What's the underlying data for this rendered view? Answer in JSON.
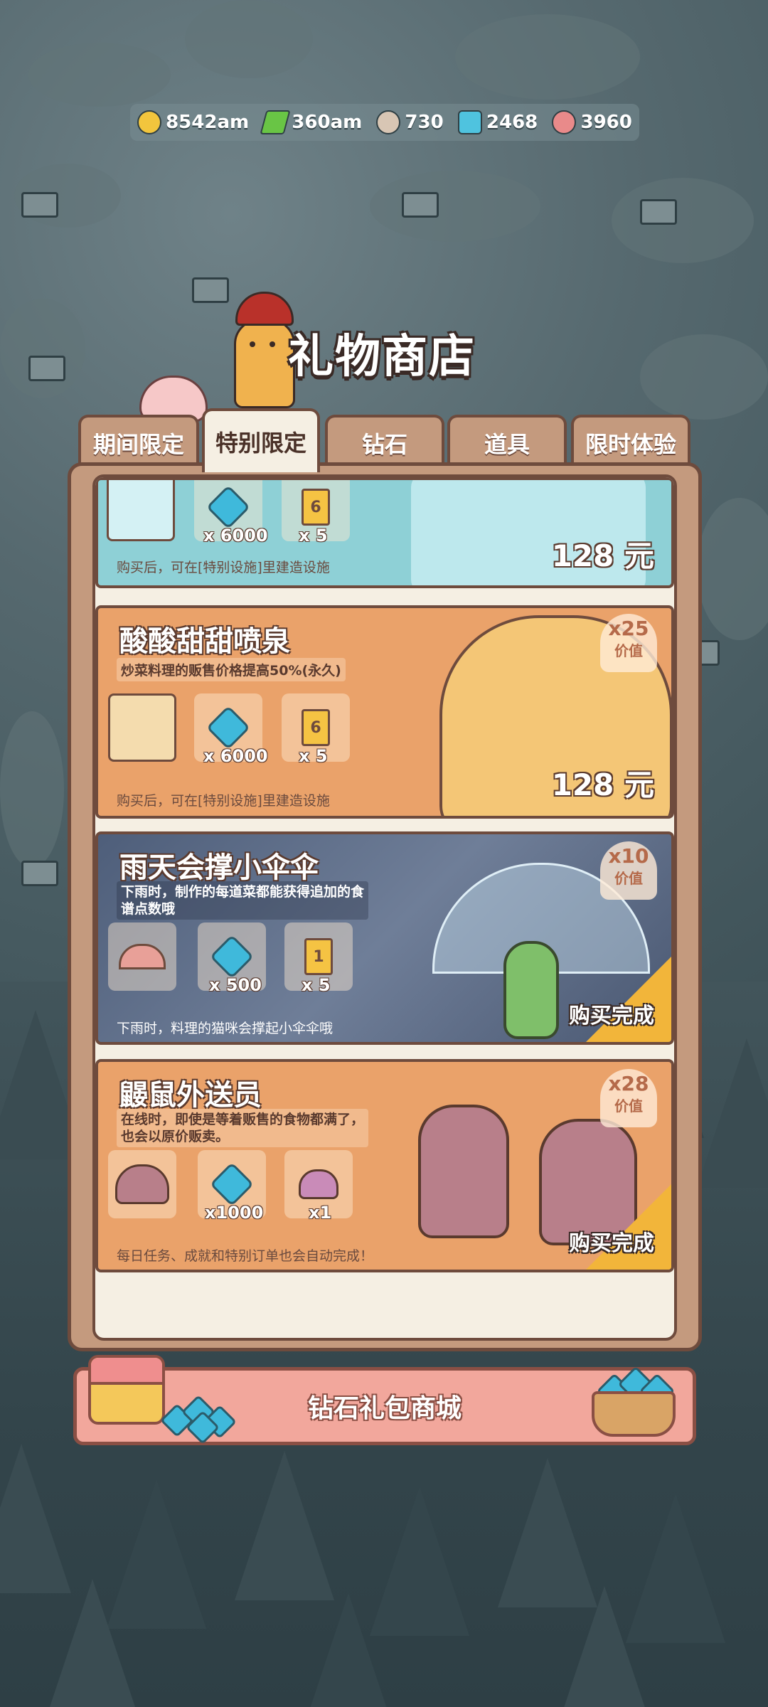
{
  "resources": [
    {
      "icon": "coin-icon",
      "value": "8542am"
    },
    {
      "icon": "lightning-icon",
      "value": "360am"
    },
    {
      "icon": "cookie-icon",
      "value": "730"
    },
    {
      "icon": "diamond-icon",
      "value": "2468"
    },
    {
      "icon": "candy-icon",
      "value": "3960"
    }
  ],
  "shop_title": "礼物商店",
  "tabs": [
    "期间限定",
    "特别限定",
    "钻石",
    "道具",
    "限时体验"
  ],
  "active_tab": "特别限定",
  "cards": {
    "ice": {
      "items": [
        {
          "label": "x 6000"
        },
        {
          "label": "x 5",
          "ticket": "6"
        }
      ],
      "footer": "购买后，可在[特别设施]里建造设施",
      "price": "128 元"
    },
    "fountain": {
      "title": "酸酸甜甜喷泉",
      "desc": "炒菜料理的贩售价格提高50%(永久)",
      "items": [
        {
          "label": "x 6000"
        },
        {
          "label": "x 5",
          "ticket": "6"
        }
      ],
      "footer": "购买后，可在[特别设施]里建造设施",
      "price": "128 元",
      "value_mult": "x25",
      "value_word": "价值"
    },
    "umbrella": {
      "title": "雨天会撑小伞伞",
      "desc_line1": "下雨时，制作的每道菜都能获得追加的食",
      "desc_line2": "谱点数哦",
      "items": [
        {
          "label": "x 500"
        },
        {
          "label": "x 5",
          "ticket": "1"
        }
      ],
      "footer": "下雨时，料理的猫咪会撑起小伞伞哦",
      "status": "购买完成",
      "value_mult": "x10",
      "value_word": "价值"
    },
    "mole": {
      "title": "鼹鼠外送员",
      "desc_line1": "在线时，即使是等着贩售的食物都满了，",
      "desc_line2": "也会以原价贩卖。",
      "items": [
        {
          "label": "x1000"
        },
        {
          "label": "x1"
        }
      ],
      "footer": "每日任务、成就和特别订单也会自动完成！",
      "status": "购买完成",
      "value_mult": "x28",
      "value_word": "价值"
    }
  },
  "banner_label": "钻石礼包商城"
}
